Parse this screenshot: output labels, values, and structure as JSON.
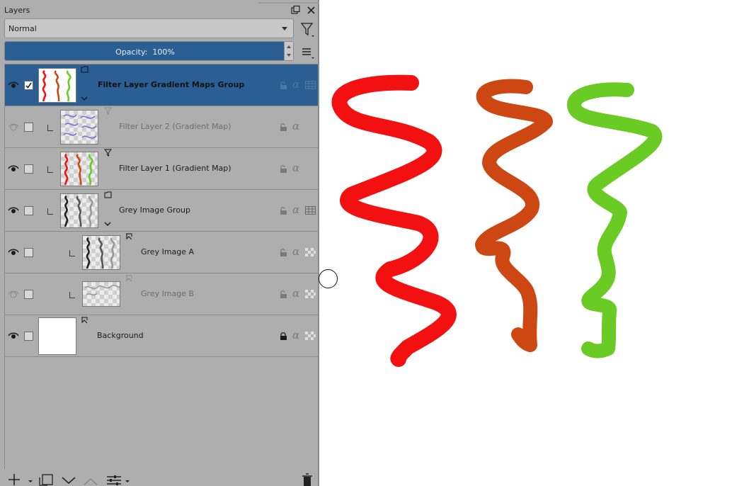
{
  "panel": {
    "title": "Layers",
    "blend_mode": "Normal",
    "opacity_label": "Opacity:",
    "opacity_value": "100%"
  },
  "layers": [
    {
      "name": "Filter Layer Gradient Maps Group",
      "visible": true,
      "selected": true,
      "checked": true,
      "type": "group",
      "indent": 0
    },
    {
      "name": "Filter Layer 2 (Gradient Map)",
      "visible": false,
      "selected": false,
      "checked": false,
      "type": "filter",
      "indent": 1
    },
    {
      "name": "Filter Layer 1 (Gradient Map)",
      "visible": true,
      "selected": false,
      "checked": false,
      "type": "filter",
      "indent": 1
    },
    {
      "name": "Grey Image Group",
      "visible": true,
      "selected": false,
      "checked": false,
      "type": "group",
      "indent": 1
    },
    {
      "name": "Grey Image A",
      "visible": true,
      "selected": false,
      "checked": false,
      "type": "paint",
      "indent": 2
    },
    {
      "name": "Grey Image B",
      "visible": false,
      "selected": false,
      "checked": false,
      "type": "paint",
      "indent": 2
    },
    {
      "name": "Background",
      "visible": true,
      "selected": false,
      "checked": false,
      "type": "paint",
      "indent": 0,
      "locked": true
    }
  ],
  "colors": {
    "selection": "#2b5f93",
    "stroke_red": "#f31010",
    "stroke_orange": "#cc4712",
    "stroke_green": "#6acb24",
    "panel_bg": "#aeaeae"
  },
  "icons": [
    "eye-icon",
    "filter-icon",
    "hamburger-menu-icon",
    "folder-icon",
    "filter-mask-icon",
    "paint-layer-icon",
    "lock-icon",
    "alpha-icon",
    "add-icon",
    "duplicate-icon",
    "move-down-icon",
    "move-up-icon",
    "properties-icon",
    "delete-icon",
    "float-icon",
    "close-icon"
  ]
}
